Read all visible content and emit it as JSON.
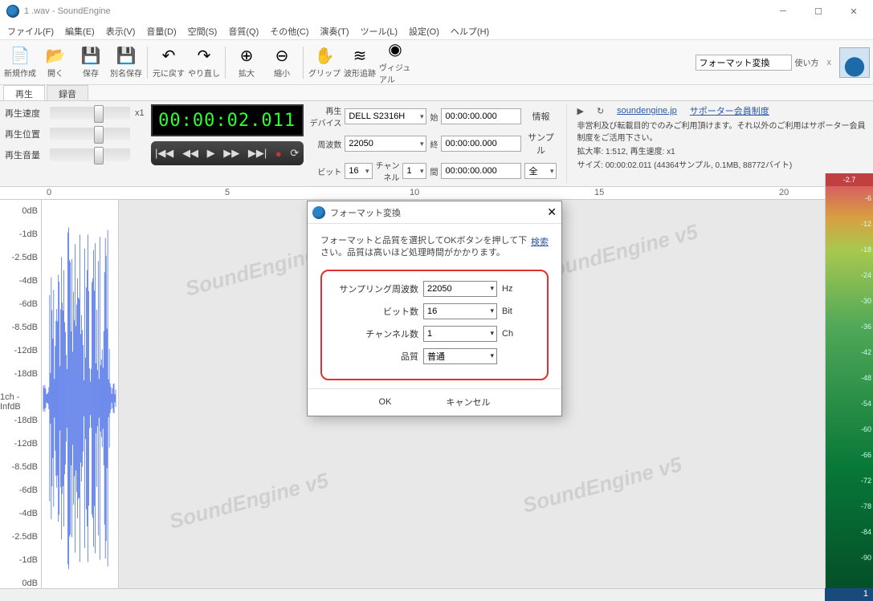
{
  "title": "1 .wav - SoundEngine",
  "menu": [
    "ファイル(F)",
    "編集(E)",
    "表示(V)",
    "音量(D)",
    "空間(S)",
    "音質(Q)",
    "その他(C)",
    "演奏(T)",
    "ツール(L)",
    "設定(O)",
    "ヘルプ(H)"
  ],
  "toolbar": [
    {
      "name": "new",
      "label": "新規作成",
      "glyph": "📄"
    },
    {
      "name": "open",
      "label": "開く",
      "glyph": "📂"
    },
    {
      "name": "save",
      "label": "保存",
      "glyph": "💾"
    },
    {
      "name": "saveas",
      "label": "別名保存",
      "glyph": "💾"
    },
    {
      "sep": true
    },
    {
      "name": "undo",
      "label": "元に戻す",
      "glyph": "↶"
    },
    {
      "name": "redo",
      "label": "やり直し",
      "glyph": "↷"
    },
    {
      "sep": true
    },
    {
      "name": "zoomin",
      "label": "拡大",
      "glyph": "⊕"
    },
    {
      "name": "zoomout",
      "label": "縮小",
      "glyph": "⊖"
    },
    {
      "sep": true
    },
    {
      "name": "grip",
      "label": "グリップ",
      "glyph": "✋"
    },
    {
      "name": "wavetrace",
      "label": "波形追跡",
      "glyph": "≋"
    },
    {
      "name": "visual",
      "label": "ヴィジュアル",
      "glyph": "◉"
    }
  ],
  "search_value": "フォーマット変換",
  "usage_label": "使い方",
  "tabs": {
    "play": "再生",
    "rec": "録音"
  },
  "controls": {
    "speed": "再生速度",
    "pos": "再生位置",
    "vol": "再生音量",
    "x1": "x1",
    "time": "00:00:02.011"
  },
  "mid": {
    "device_lbl": "再生\nデバイス",
    "device": "DELL S2316H",
    "start_lbl": "始",
    "start": "00:00:00.000",
    "info_lbl": "情報",
    "freq_lbl": "周波数",
    "freq": "22050",
    "end_lbl": "終",
    "end": "00:00:00.000",
    "sample_lbl": "サンプル",
    "bit_lbl": "ビット",
    "bit": "16",
    "ch_lbl": "チャン\nネル",
    "ch": "1",
    "span_lbl": "間",
    "span": "00:00:00.000",
    "all_lbl": "全"
  },
  "right": {
    "site": "soundengine.jp",
    "supporter": "サポーター会員制度",
    "line1": "非営利及び転載目的でのみご利用頂けます。それ以外のご利用はサポーター会員制度をご活用下さい。",
    "line2": "拡大率: 1:512, 再生速度: x1",
    "line3": "サイズ: 00:00:02.011 (44364サンプル, 0.1MB, 88772バイト)"
  },
  "ruler": {
    "0": "0",
    "5": "5",
    "10": "10",
    "15": "15",
    "20": "20"
  },
  "db_labels": [
    "0dB",
    "-1dB",
    "-2.5dB",
    "-4dB",
    "-6dB",
    "-8.5dB",
    "-12dB",
    "-18dB",
    "1ch -InfdB",
    "-18dB",
    "-12dB",
    "-8.5dB",
    "-6dB",
    "-4dB",
    "-2.5dB",
    "-1dB",
    "0dB"
  ],
  "meter_top": "-2.7",
  "meter_ticks": [
    "-6",
    "-12",
    "-18",
    "-24",
    "-30",
    "-36",
    "-42",
    "-48",
    "-54",
    "-60",
    "-66",
    "-72",
    "-78",
    "-84",
    "-90"
  ],
  "dialog": {
    "title": "フォーマット変換",
    "desc": "フォーマットと品質を選択してOKボタンを押して下さい。品質は高いほど処理時間がかかります。",
    "search": "検索",
    "rows": [
      {
        "label": "サンプリング周波数",
        "value": "22050",
        "unit": "Hz"
      },
      {
        "label": "ビット数",
        "value": "16",
        "unit": "Bit"
      },
      {
        "label": "チャンネル数",
        "value": "1",
        "unit": "Ch"
      },
      {
        "label": "品質",
        "value": "普通",
        "unit": ""
      }
    ],
    "ok": "OK",
    "cancel": "キャンセル"
  },
  "status_num": "1"
}
